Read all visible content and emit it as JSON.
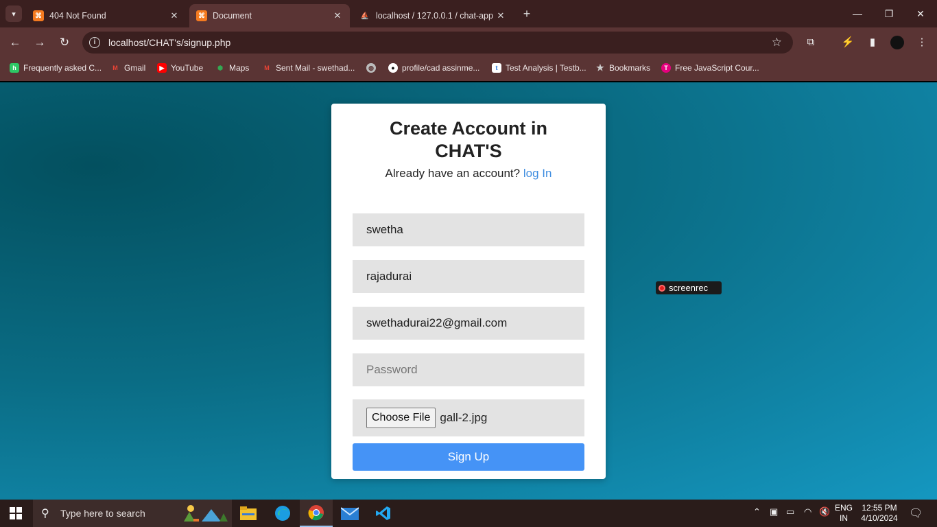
{
  "browser": {
    "tabs": [
      {
        "title": "404 Not Found",
        "favicon": "xampp-icon",
        "active": false
      },
      {
        "title": "Document",
        "favicon": "xampp-icon",
        "active": true
      },
      {
        "title": "localhost / 127.0.0.1 / chat-app",
        "favicon": "phpmyadmin-icon",
        "active": false
      }
    ],
    "address": "localhost/CHAT's/signup.php",
    "bookmarks": [
      {
        "label": "Frequently asked C...",
        "icon": "hackerrank-icon",
        "color": "#2ec866"
      },
      {
        "label": "Gmail",
        "icon": "gmail-icon",
        "color": "#ea4335"
      },
      {
        "label": "YouTube",
        "icon": "youtube-icon",
        "color": "#ff0000"
      },
      {
        "label": "Maps",
        "icon": "maps-icon",
        "color": "#34a853"
      },
      {
        "label": "Sent Mail - swethad...",
        "icon": "gmail-icon",
        "color": "#ea4335"
      },
      {
        "label": "",
        "icon": "globe-icon",
        "color": "#bbbbbb"
      },
      {
        "label": "profile/cad assinme...",
        "icon": "github-icon",
        "color": "#ffffff"
      },
      {
        "label": "Test Analysis | Testb...",
        "icon": "testbook-icon",
        "color": "#ffffff"
      },
      {
        "label": "Bookmarks",
        "icon": "star-icon",
        "color": "#cccccc"
      },
      {
        "label": "Free JavaScript Cour...",
        "icon": "scrimba-icon",
        "color": "#e6007e"
      }
    ]
  },
  "form": {
    "title": "Create Account in CHAT'S",
    "subtitle": "Already have an account?",
    "login_link": "log In",
    "first_name": "swetha",
    "last_name": "rajadurai",
    "email": "swethadurai22@gmail.com",
    "password_placeholder": "Password",
    "file_button": "Choose File",
    "file_name": "gall-2.jpg",
    "submit_label": "Sign Up"
  },
  "overlay": {
    "screenrec_label": "screenrec"
  },
  "taskbar": {
    "search_placeholder": "Type here to search",
    "language": "ENG",
    "region": "IN",
    "time": "12:55 PM",
    "date": "4/10/2024"
  },
  "colors": {
    "accent": "#4593f6",
    "link": "#3f8de0",
    "chrome": "#5a3434"
  }
}
